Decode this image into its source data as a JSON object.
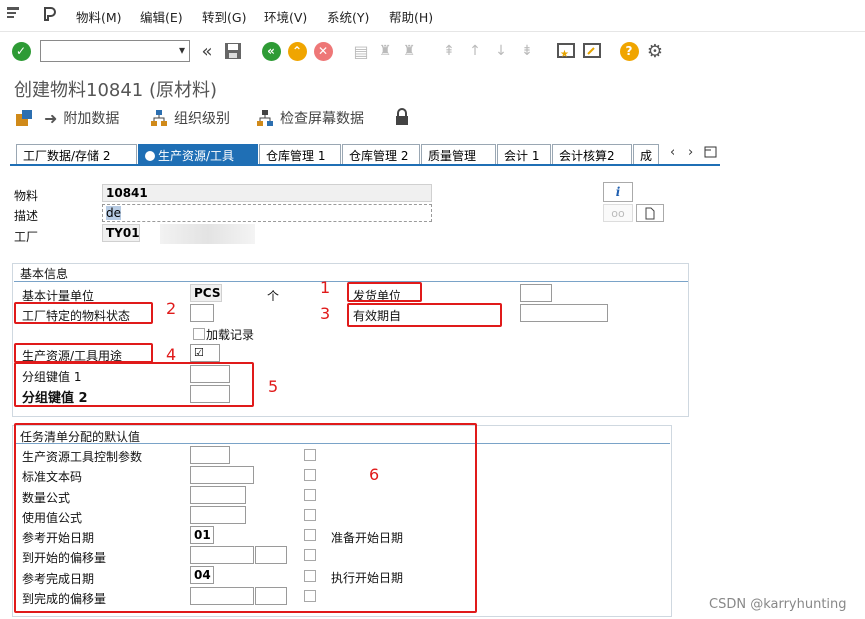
{
  "menu": {
    "items": [
      "物料(M)",
      "编辑(E)",
      "转到(G)",
      "环境(V)",
      "系统(Y)",
      "帮助(H)"
    ]
  },
  "toolbar": {
    "command_field": ""
  },
  "title": "创建物料10841 (原材料)",
  "app_toolbar": {
    "additional_data": "附加数据",
    "org_levels": "组织级别",
    "check_screen_data": "检查屏幕数据"
  },
  "tabs": [
    "工厂数据/存储 2",
    "生产资源/工具",
    "仓库管理 1",
    "仓库管理 2",
    "质量管理",
    "会计 1",
    "会计核算2",
    "成"
  ],
  "header_fields": {
    "material_label": "物料",
    "material_value": "10841",
    "description_label": "描述",
    "description_value": "de",
    "plant_label": "工厂",
    "plant_value": "TY01"
  },
  "basic_info": {
    "title": "基本信息",
    "base_uom_label": "基本计量单位",
    "base_uom_value": "PCS",
    "base_uom_text": "个",
    "issue_unit_label": "发货单位",
    "plant_status_label": "工厂特定的物料状态",
    "valid_from_label": "有效期自",
    "load_records_label": "加载记录",
    "prt_usage_label": "生产资源/工具用途",
    "prt_usage_value": "☑",
    "group_key1_label": "分组键值 1",
    "group_key2_label": "分组键值 2"
  },
  "task_defaults": {
    "title": "任务清单分配的默认值",
    "rows": [
      {
        "label": "生产资源工具控制参数",
        "value": ""
      },
      {
        "label": "标准文本码",
        "value": ""
      },
      {
        "label": "数量公式",
        "value": ""
      },
      {
        "label": "使用值公式",
        "value": ""
      },
      {
        "label": "参考开始日期",
        "value": "01"
      },
      {
        "label": "到开始的偏移量",
        "value": ""
      },
      {
        "label": "参考完成日期",
        "value": "04"
      },
      {
        "label": "到完成的偏移量",
        "value": ""
      }
    ],
    "ready_start_label": "准备开始日期",
    "exec_start_label": "执行开始日期"
  },
  "annotations": [
    "1",
    "2",
    "3",
    "4",
    "5",
    "6"
  ],
  "watermark": "CSDN @karryhunting"
}
